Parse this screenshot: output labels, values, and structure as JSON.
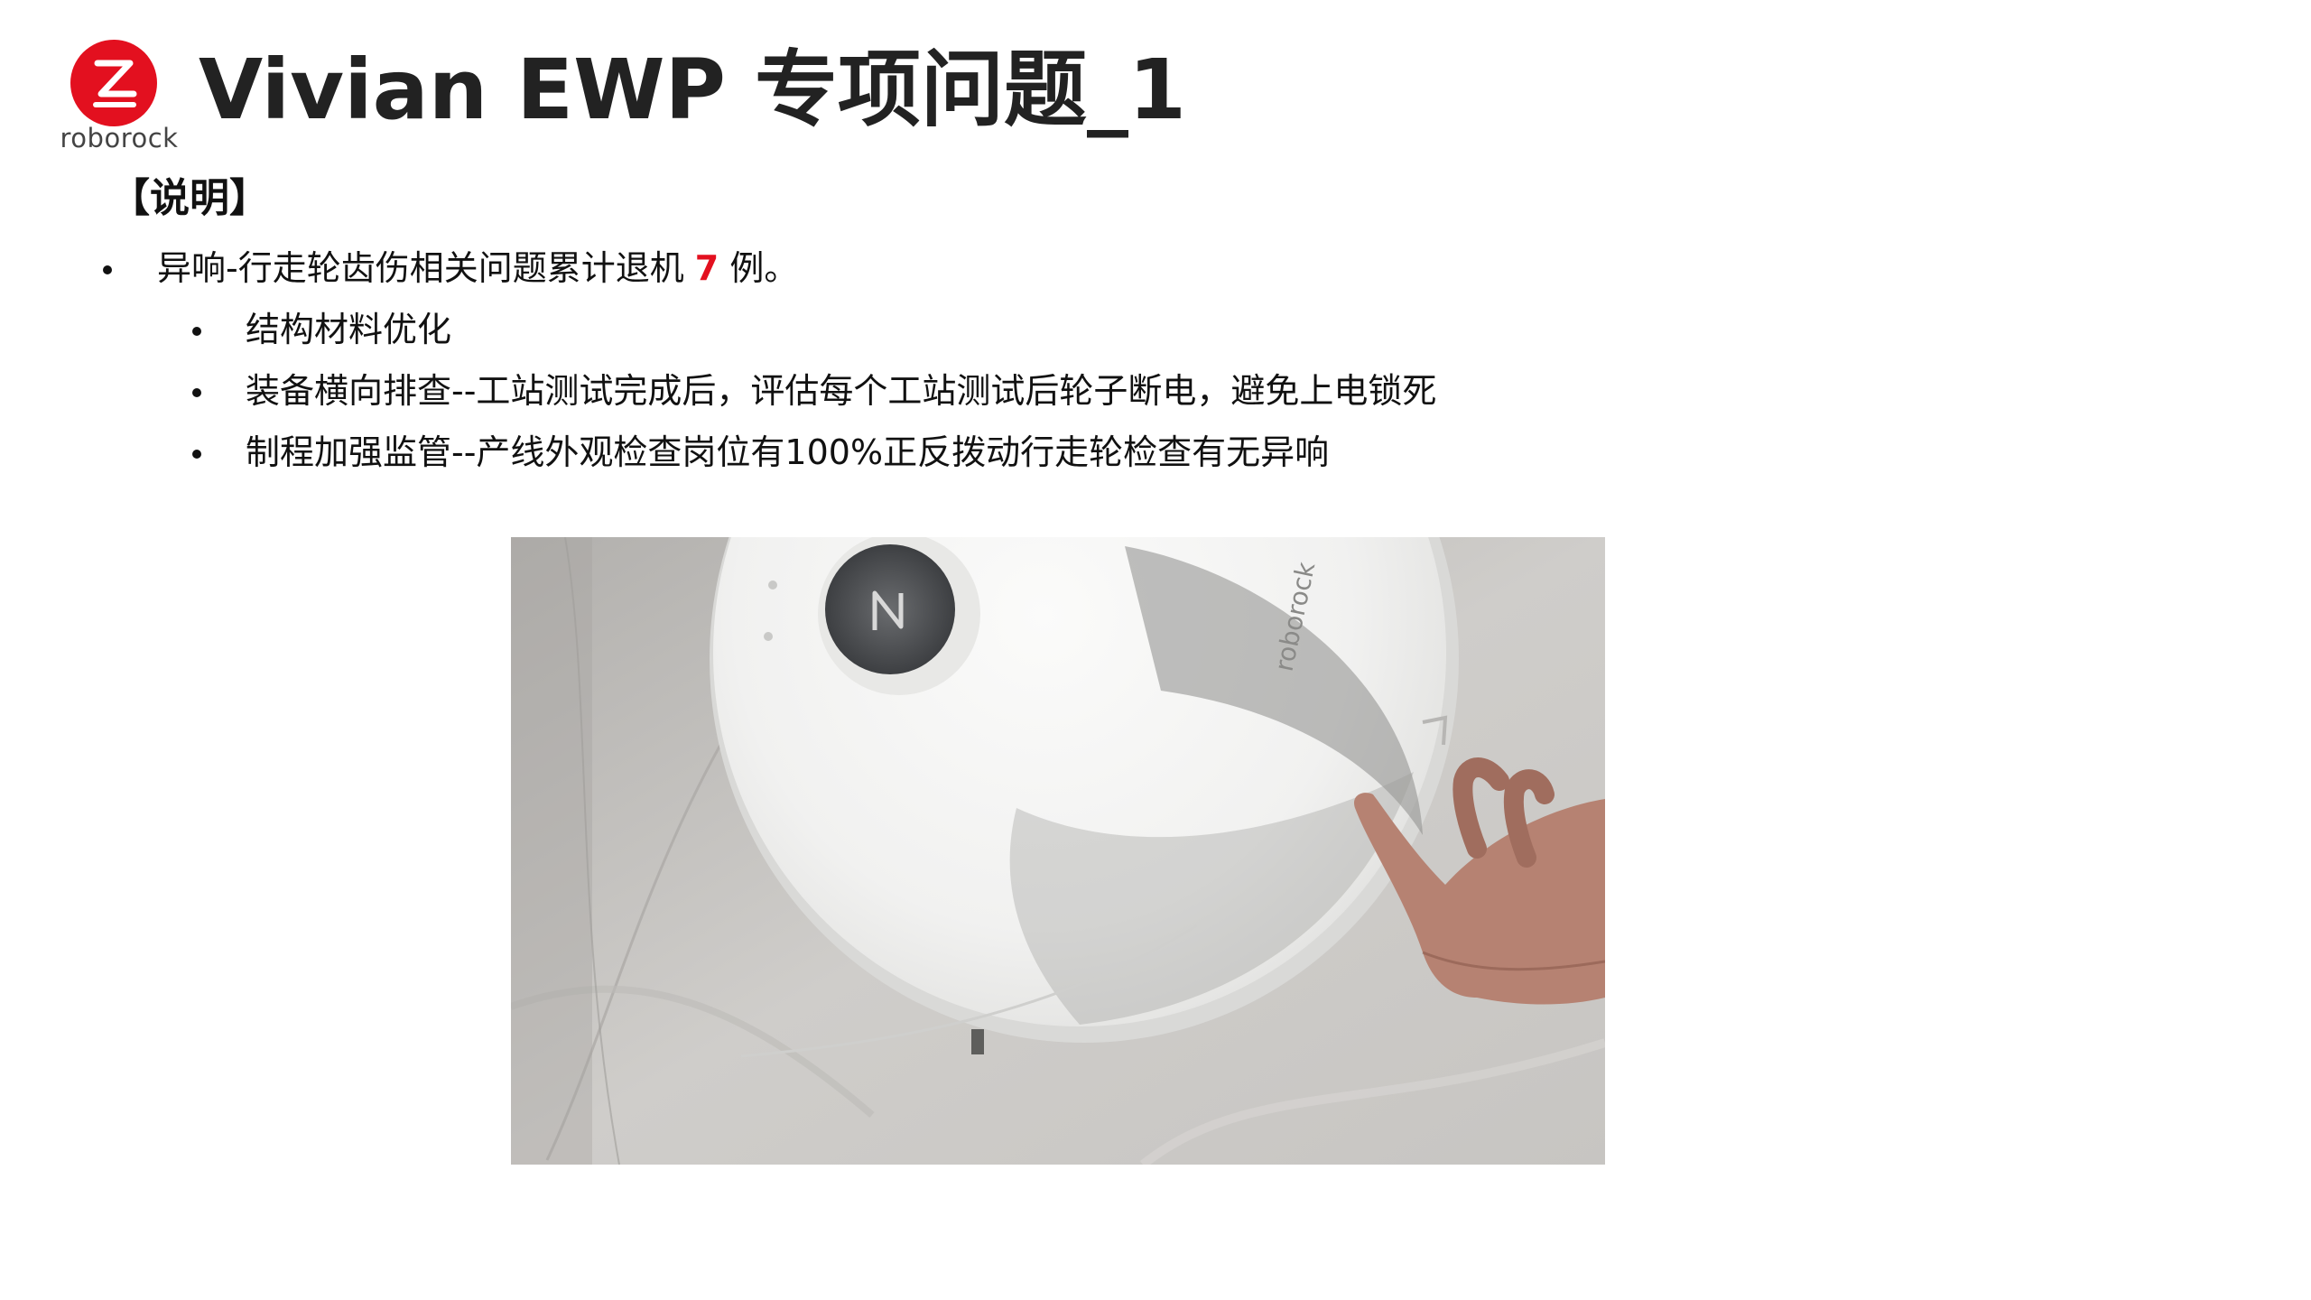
{
  "logo": {
    "brand_word": "roborock"
  },
  "slide": {
    "title": "Vivian EWP 专项问题_1"
  },
  "section": {
    "heading": "【说明】"
  },
  "bullets": {
    "main": {
      "prefix": "异响-行走轮齿伤相关问题累计退机 ",
      "count": "7",
      "suffix": " 例。"
    },
    "subs": [
      {
        "text": "结构材料优化"
      },
      {
        "text": "装备横向排查--工站测试完成后，评估每个工站测试后轮子断电，避免上电锁死"
      },
      {
        "text": "制程加强监管--产线外观检查岗位有100%正反拨动行走轮检查有无异响"
      }
    ]
  },
  "photo": {
    "device_brand": "roborock",
    "colors": {
      "floor": "#c4c2bf",
      "device": "#f4f4f3",
      "accent": "#e3101f"
    }
  }
}
